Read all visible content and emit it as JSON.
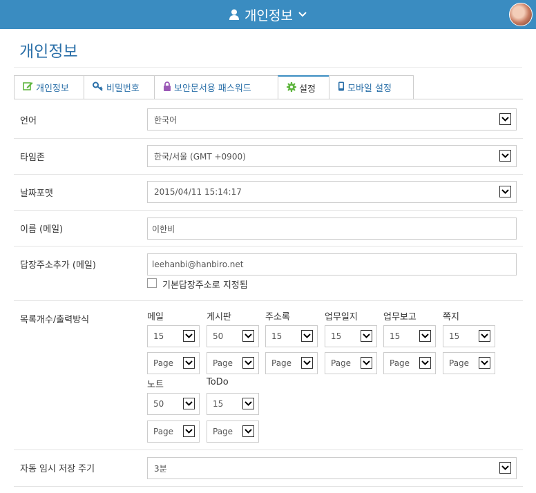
{
  "header": {
    "title": "개인정보"
  },
  "page": {
    "title": "개인정보"
  },
  "tabs": [
    {
      "label": "개인정보",
      "icon": "edit-icon",
      "color": "#5fb53f"
    },
    {
      "label": "비밀번호",
      "icon": "key-icon",
      "color": "#2a6fa8"
    },
    {
      "label": "보안문서용 패스워드",
      "icon": "lock-icon",
      "color": "#9b59b6"
    },
    {
      "label": "설정",
      "icon": "gear-icon",
      "color": "#5fb53f"
    },
    {
      "label": "모바일 설정",
      "icon": "mobile-icon",
      "color": "#2a6fa8"
    }
  ],
  "settings": {
    "language": {
      "label": "언어",
      "value": "한국어"
    },
    "timezone": {
      "label": "타임존",
      "value": "한국/서울 (GMT +0900)"
    },
    "date_format": {
      "label": "날짜포맷",
      "value": "2015/04/11 15:14:17"
    },
    "mail_name": {
      "label": "이름 (메일)",
      "value": "이한비"
    },
    "reply_address": {
      "label": "답장주소추가 (메일)",
      "value": "leehanbi@hanbiro.net",
      "checkbox_label": "기본답장주소로 지정됨"
    },
    "list_count": {
      "label": "목록개수/출력방식",
      "columns": [
        {
          "name": "메일",
          "count": "15",
          "mode": "Page"
        },
        {
          "name": "게시판",
          "count": "50",
          "mode": "Page"
        },
        {
          "name": "주소록",
          "count": "15",
          "mode": "Page"
        },
        {
          "name": "업무일지",
          "count": "15",
          "mode": "Page"
        },
        {
          "name": "업무보고",
          "count": "15",
          "mode": "Page"
        },
        {
          "name": "쪽지",
          "count": "15",
          "mode": "Page"
        },
        {
          "name": "노트",
          "count": "50",
          "mode": "Page"
        },
        {
          "name": "ToDo",
          "count": "15",
          "mode": "Page"
        }
      ]
    },
    "autosave": {
      "label": "자동 임시 저장 주기",
      "value": "3분"
    }
  },
  "colors": {
    "header_bg": "#3a8cc1",
    "title": "#2a6fa8"
  }
}
